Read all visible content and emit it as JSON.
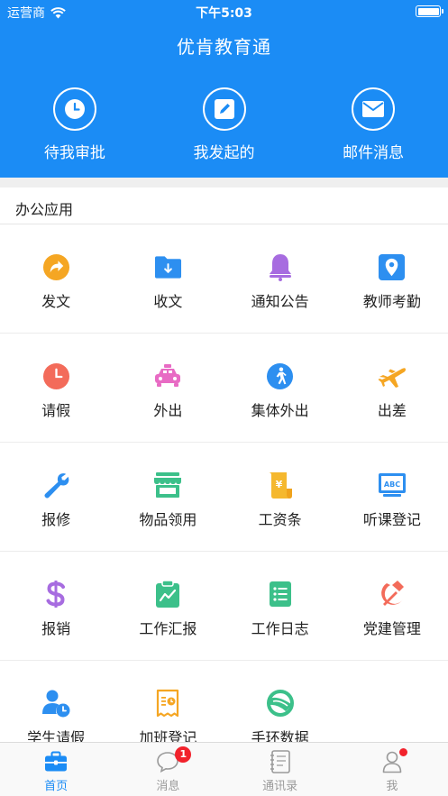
{
  "status_bar": {
    "carrier": "运营商",
    "time": "下午5:03"
  },
  "app_title": "优肯教育通",
  "quick_actions": [
    {
      "label": "待我审批",
      "icon": "clock-icon"
    },
    {
      "label": "我发起的",
      "icon": "edit-icon"
    },
    {
      "label": "邮件消息",
      "icon": "mail-icon"
    }
  ],
  "section": {
    "title": "办公应用"
  },
  "apps": [
    {
      "label": "发文",
      "icon": "share-arrow-icon",
      "color": "#f5a623"
    },
    {
      "label": "收文",
      "icon": "download-folder-icon",
      "color": "#2d8ff0"
    },
    {
      "label": "通知公告",
      "icon": "bell-icon",
      "color": "#a76ce0"
    },
    {
      "label": "教师考勤",
      "icon": "location-pin-icon",
      "color": "#2d8ff0"
    },
    {
      "label": "请假",
      "icon": "clock-icon",
      "color": "#f36b5a"
    },
    {
      "label": "外出",
      "icon": "taxi-icon",
      "color": "#e86bc4"
    },
    {
      "label": "集体外出",
      "icon": "walking-person-icon",
      "color": "#2d8ff0"
    },
    {
      "label": "出差",
      "icon": "airplane-icon",
      "color": "#f5a623"
    },
    {
      "label": "报修",
      "icon": "wrench-icon",
      "color": "#2d8ff0"
    },
    {
      "label": "物品领用",
      "icon": "store-icon",
      "color": "#3cc08a"
    },
    {
      "label": "工资条",
      "icon": "salary-scroll-icon",
      "color": "#f5b82e"
    },
    {
      "label": "听课登记",
      "icon": "abc-board-icon",
      "color": "#2d8ff0"
    },
    {
      "label": "报销",
      "icon": "dollar-icon",
      "color": "#a76ce0"
    },
    {
      "label": "工作汇报",
      "icon": "report-chart-icon",
      "color": "#3cc08a"
    },
    {
      "label": "工作日志",
      "icon": "log-list-icon",
      "color": "#3cc08a"
    },
    {
      "label": "党建管理",
      "icon": "hammer-sickle-icon",
      "color": "#f36b5a"
    },
    {
      "label": "学生请假",
      "icon": "student-clock-icon",
      "color": "#2d8ff0"
    },
    {
      "label": "加班登记",
      "icon": "overtime-receipt-icon",
      "color": "#f5a623"
    },
    {
      "label": "手环数据",
      "icon": "wristband-icon",
      "color": "#3cc08a"
    }
  ],
  "tabs": [
    {
      "label": "首页",
      "icon": "briefcase-icon",
      "active": true
    },
    {
      "label": "消息",
      "icon": "chat-bubble-icon",
      "badge": "1"
    },
    {
      "label": "通讯录",
      "icon": "address-book-icon"
    },
    {
      "label": "我",
      "icon": "person-icon",
      "dot": true
    }
  ],
  "colors": {
    "primary": "#1b8cf5",
    "badge": "#f2222c"
  }
}
